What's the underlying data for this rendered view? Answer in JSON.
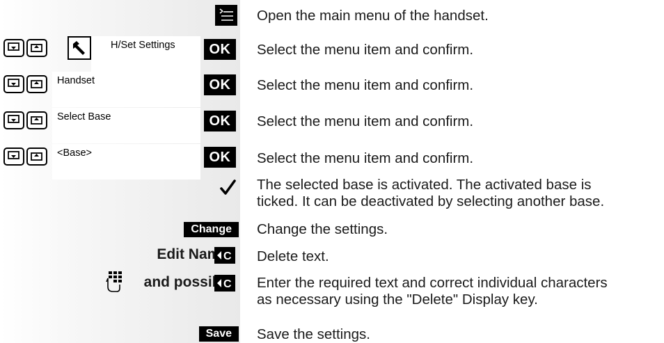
{
  "steps": {
    "open_menu": "Open the main menu of the handset.",
    "row1_desc": "Select the menu item and confirm.",
    "row2_desc": "Select the menu item and confirm.",
    "row3_desc": "Select the menu item and confirm.",
    "row4_desc": "Select the menu item and confirm.",
    "activated_line1": "The selected base is activated. The activated base is",
    "activated_line2": "ticked. It can be deactivated by selecting another base.",
    "change_desc": "Change the settings.",
    "delete_desc": "Delete text.",
    "enter_line1": "Enter the required text and correct individual characters",
    "enter_line2": "as necessary using the \"Delete\" Display key.",
    "save_desc": "Save the settings."
  },
  "displays": {
    "row1": "H/Set Settings",
    "row2": "Handset",
    "row3": "Select Base",
    "row4": "<Base>"
  },
  "keys": {
    "ok": "OK",
    "change": "Change",
    "save": "Save",
    "edit_name": "Edit Name:",
    "and_possibly": "and possibly",
    "c_key": "C"
  },
  "icons": {
    "menu": "main-menu-icon",
    "down": "navigate-down-icon",
    "up": "navigate-up-icon",
    "settings": "wrench-settings-icon",
    "check": "checkmark-icon",
    "keypad": "keypad-hand-icon",
    "delete": "delete-c-icon"
  }
}
